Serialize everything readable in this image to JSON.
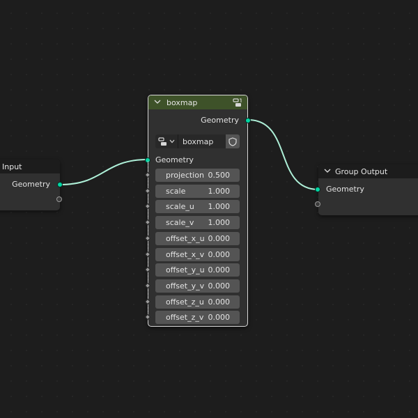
{
  "input_node": {
    "title": "Input",
    "output_socket_label": "Geometry"
  },
  "boxmap_node": {
    "title": "boxmap",
    "output_socket_label": "Geometry",
    "group_selector_value": "boxmap",
    "input_socket_label": "Geometry",
    "fields": [
      {
        "label": "projection",
        "value": "0.500"
      },
      {
        "label": "scale",
        "value": "1.000"
      },
      {
        "label": "scale_u",
        "value": "1.000"
      },
      {
        "label": "scale_v",
        "value": "1.000"
      },
      {
        "label": "offset_x_u",
        "value": "0.000"
      },
      {
        "label": "offset_x_v",
        "value": "0.000"
      },
      {
        "label": "offset_y_u",
        "value": "0.000"
      },
      {
        "label": "offset_y_v",
        "value": "0.000"
      },
      {
        "label": "offset_z_u",
        "value": "0.000"
      },
      {
        "label": "offset_z_v",
        "value": "0.000"
      }
    ]
  },
  "output_node": {
    "title": "Group Output",
    "input_socket_label": "Geometry"
  },
  "colors": {
    "canvas": "#1d1d1d",
    "node_body": "#303030",
    "group_header": "#3e5229",
    "geometry_socket": "#00d6a3",
    "link": "#aef0d8",
    "field": "#545454"
  },
  "icons": {
    "collapse": "chevron-down-icon",
    "node_group": "node-tree-icon",
    "fake_user": "shield-icon"
  }
}
